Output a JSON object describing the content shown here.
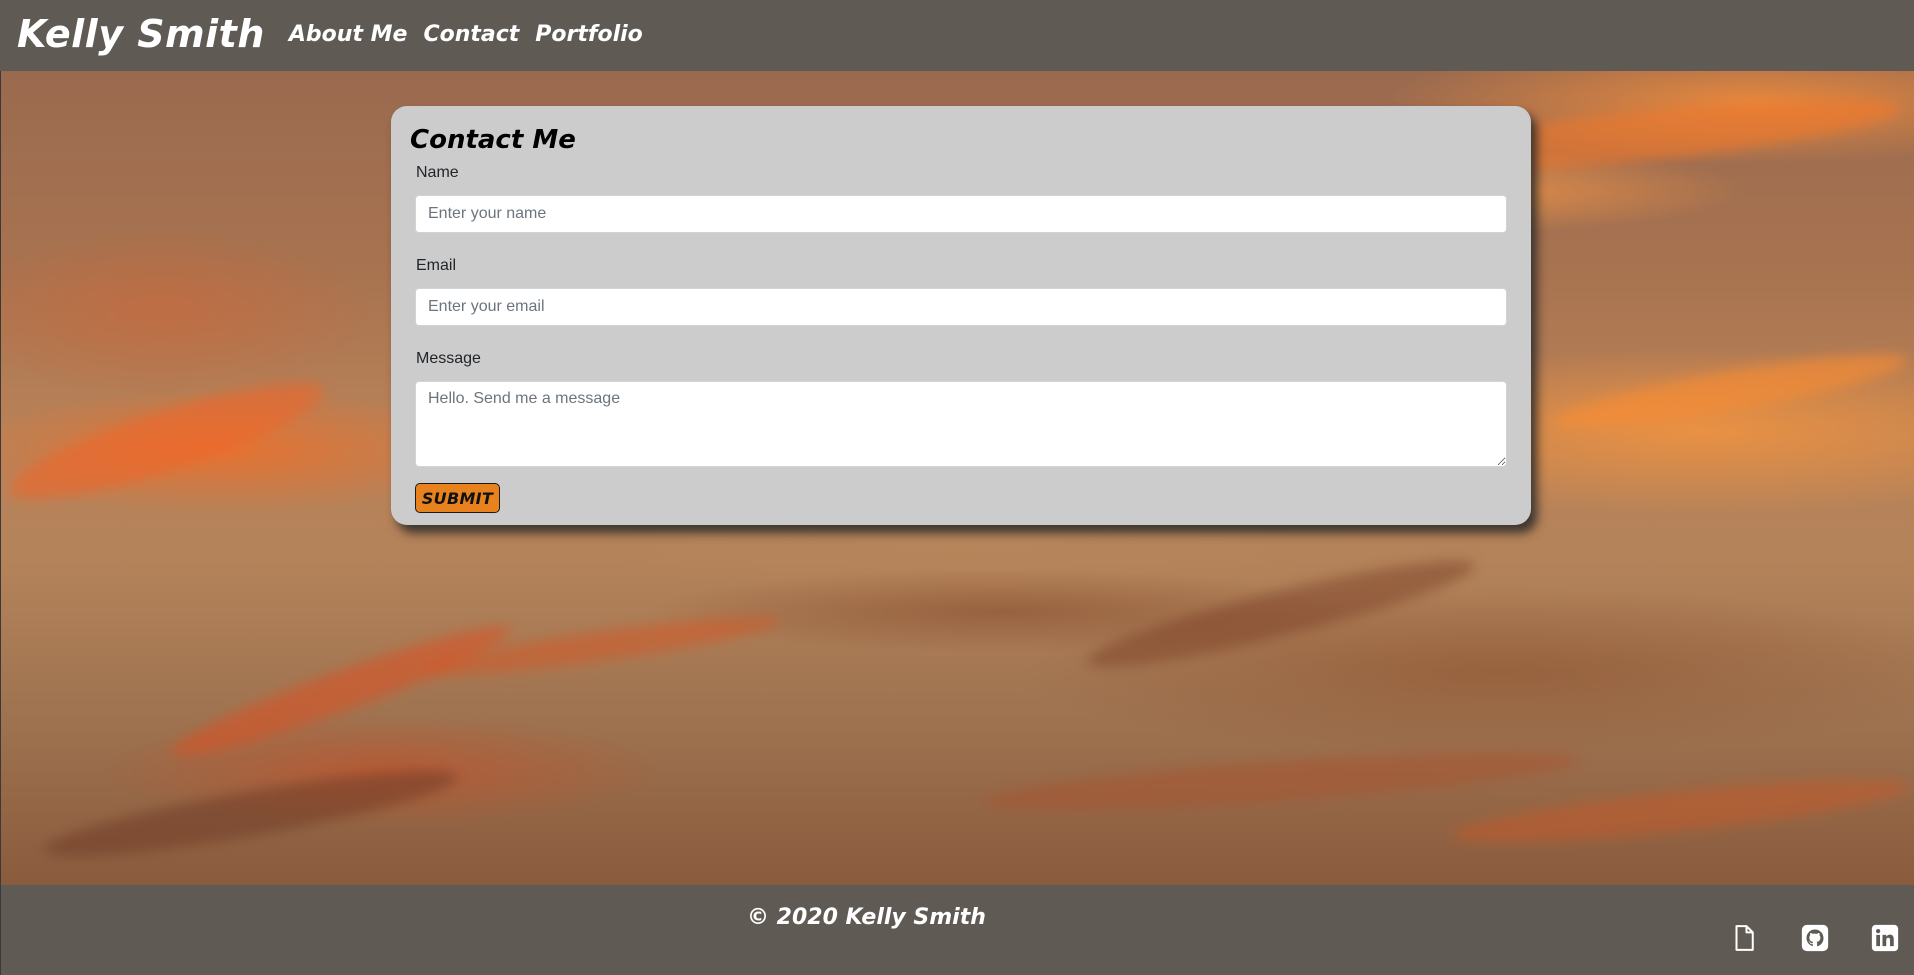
{
  "nav": {
    "brand": "Kelly Smith",
    "links": [
      "About Me",
      "Contact",
      "Portfolio"
    ]
  },
  "contact_form": {
    "title": "Contact Me",
    "name_label": "Name",
    "name_placeholder": "Enter your name",
    "name_value": "",
    "email_label": "Email",
    "email_placeholder": "Enter your email",
    "email_value": "",
    "message_label": "Message",
    "message_placeholder": "Hello. Send me a message",
    "message_value": "",
    "submit_label": "SUBMIT"
  },
  "footer": {
    "copyright": "© 2020 Kelly Smith",
    "icons": [
      "resume-file-icon",
      "github-icon",
      "linkedin-icon"
    ]
  },
  "colors": {
    "nav_bg": "#5f5b54",
    "card_bg": "#cccccc",
    "submit_bg": "#e8821e",
    "text_light": "#ffffff"
  }
}
